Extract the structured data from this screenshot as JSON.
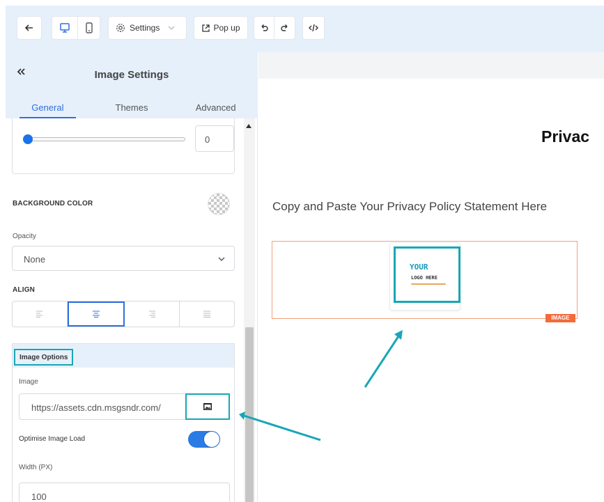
{
  "toolbar": {
    "settings_label": "Settings",
    "popup_label": "Pop up"
  },
  "panel": {
    "title": "Image Settings",
    "tabs": [
      {
        "label": "General",
        "active": true
      },
      {
        "label": "Themes",
        "active": false
      },
      {
        "label": "Advanced",
        "active": false
      }
    ],
    "slider_value": "0",
    "background_color_label": "BACKGROUND COLOR",
    "opacity_label": "Opacity",
    "opacity_value": "None",
    "align_label": "ALIGN",
    "align_selected": "center",
    "image_options": {
      "title": "Image Options",
      "image_label": "Image",
      "image_url": "https://assets.cdn.msgsndr.com/",
      "optimise_label": "Optimise Image Load",
      "optimise_enabled": true,
      "width_label": "Width (PX)",
      "width_value": "100"
    }
  },
  "canvas": {
    "heading": "Privac",
    "body_text": "Copy and Paste Your Privacy Policy Statement Here",
    "image_tag": "IMAGE",
    "logo_line1": "YOUR",
    "logo_line2": "LOGO HERE"
  },
  "colors": {
    "accent_blue": "#2f6fe0",
    "toggle_blue": "#2a7be4",
    "highlight_teal": "#16a7b5",
    "image_border": "#f4a07a",
    "image_tag": "#f26b3a",
    "header_bg": "#e6f0fb"
  }
}
